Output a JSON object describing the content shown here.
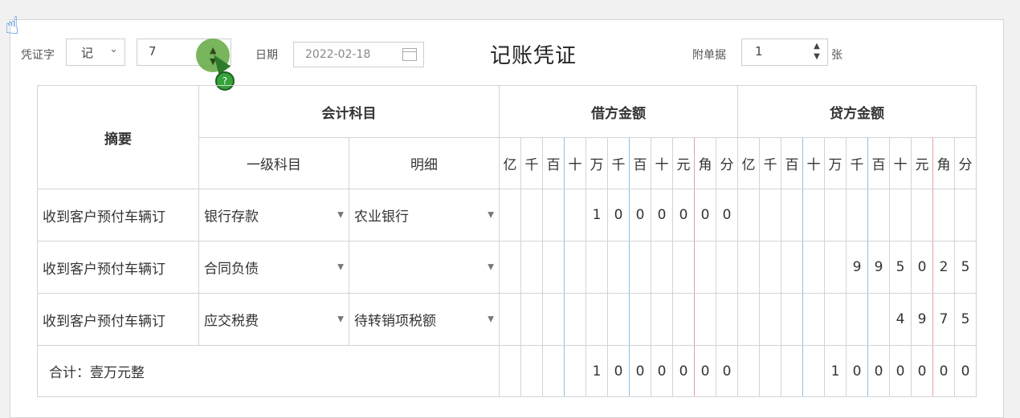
{
  "toolbar": {
    "voucher_word_label": "凭证字",
    "voucher_word_value": "记",
    "voucher_number": "7",
    "date_label": "日期",
    "date_value": "2022-02-18",
    "title": "记账凭证",
    "attachments_label": "附单据",
    "attachments_value": "1",
    "attachments_unit": "张"
  },
  "table": {
    "summary_header": "摘要",
    "account_header": "会计科目",
    "primary_account_header": "一级科目",
    "detail_header": "明细",
    "debit_header": "借方金额",
    "credit_header": "贷方金额",
    "digit_units": [
      "亿",
      "千",
      "百",
      "十",
      "万",
      "千",
      "百",
      "十",
      "元",
      "角",
      "分"
    ],
    "rows": [
      {
        "summary": "收到客户预付车辆订",
        "account": "银行存款",
        "detail": "农业银行",
        "debit": [
          "",
          "",
          "",
          "",
          "1",
          "0",
          "0",
          "0",
          "0",
          "0",
          "0"
        ],
        "credit": [
          "",
          "",
          "",
          "",
          "",
          "",
          "",
          "",
          "",
          "",
          ""
        ]
      },
      {
        "summary": "收到客户预付车辆订",
        "account": "合同负债",
        "detail": "",
        "debit": [
          "",
          "",
          "",
          "",
          "",
          "",
          "",
          "",
          "",
          "",
          ""
        ],
        "credit": [
          "",
          "",
          "",
          "",
          "",
          "9",
          "9",
          "5",
          "0",
          "2",
          "5"
        ]
      },
      {
        "summary": "收到客户预付车辆订",
        "account": "应交税费",
        "detail": "待转销项税额",
        "debit": [
          "",
          "",
          "",
          "",
          "",
          "",
          "",
          "",
          "",
          "",
          ""
        ],
        "credit": [
          "",
          "",
          "",
          "",
          "",
          "",
          "",
          "4",
          "9",
          "7",
          "5"
        ]
      }
    ],
    "total_label": "合计：壹万元整",
    "total_debit": [
      "",
      "",
      "",
      "",
      "1",
      "0",
      "0",
      "0",
      "0",
      "0",
      "0"
    ],
    "total_credit": [
      "",
      "",
      "",
      "",
      "1",
      "0",
      "0",
      "0",
      "0",
      "0",
      "0"
    ]
  },
  "icons": {
    "calendar": "calendar-icon",
    "chevron": "chevron-down-icon",
    "spinner": "spinner-arrows-icon",
    "cursor": "hand-cursor-icon"
  },
  "colors": {
    "blue_divider": "#8ec0e6",
    "red_divider": "#e6a0a0",
    "highlight_green": "#60a840"
  }
}
